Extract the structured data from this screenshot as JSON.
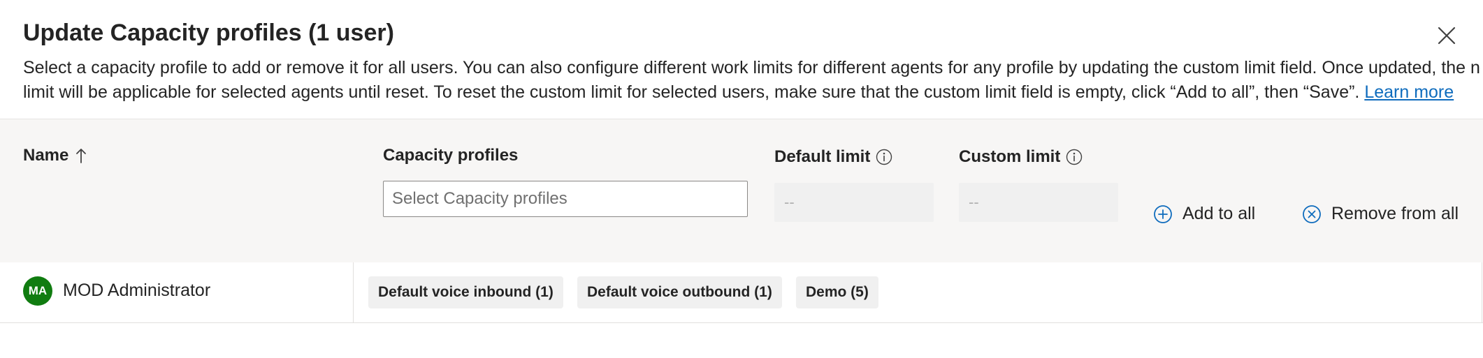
{
  "dialog": {
    "title": "Update Capacity profiles (1 user)",
    "description_line1": "Select a capacity profile to add or remove it for all users. You can also configure different work limits for different agents for any profile by updating the custom limit field. Once updated, the new",
    "description_line2": "limit will be applicable for selected agents until reset. To reset the custom limit for selected users, make sure that the custom limit field is empty, click “Add to all”, then “Save”. ",
    "learn_more": "Learn more"
  },
  "toolbar": {
    "name_header": "Name",
    "capacity_header": "Capacity profiles",
    "capacity_placeholder": "Select Capacity profiles",
    "default_limit_header": "Default limit",
    "default_limit_value": "--",
    "custom_limit_header": "Custom limit",
    "custom_limit_value": "--",
    "add_to_all": "Add to all",
    "remove_from_all": "Remove from all"
  },
  "users": [
    {
      "initials": "MA",
      "name": "MOD Administrator",
      "profiles": [
        "Default voice inbound (1)",
        "Default voice outbound (1)",
        "Demo (5)"
      ]
    }
  ],
  "icons": {
    "close": "close-icon",
    "sort": "arrow-up-icon",
    "info": "info-icon",
    "add": "plus-circle-icon",
    "remove": "x-circle-icon"
  },
  "colors": {
    "accent": "#0f6cbd",
    "avatar": "#107c10",
    "toolbar_bg": "#f7f6f5",
    "chip_bg": "#f0f0f0"
  }
}
